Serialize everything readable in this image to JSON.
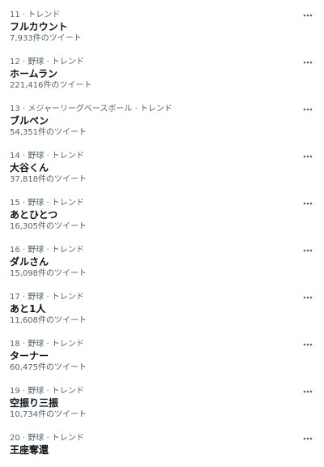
{
  "trends": [
    {
      "meta": "11 · トレンド",
      "name": "フルカウント",
      "count": "7,933件のツイート"
    },
    {
      "meta": "12 · 野球 · トレンド",
      "name": "ホームラン",
      "count": "221,416件のツイート"
    },
    {
      "meta": "13 · メジャーリーグベースボール · トレンド",
      "name": "ブルペン",
      "count": "54,351件のツイート"
    },
    {
      "meta": "14 · 野球 · トレンド",
      "name": "大谷くん",
      "count": "37,818件のツイート"
    },
    {
      "meta": "15 · 野球 · トレンド",
      "name": "あとひとつ",
      "count": "16,305件のツイート"
    },
    {
      "meta": "16 · 野球 · トレンド",
      "name": "ダルさん",
      "count": "15,098件のツイート"
    },
    {
      "meta": "17 · 野球 · トレンド",
      "name": "あと1人",
      "count": "11,608件のツイート"
    },
    {
      "meta": "18 · 野球 · トレンド",
      "name": "ターナー",
      "count": "60,475件のツイート"
    },
    {
      "meta": "19 · 野球 · トレンド",
      "name": "空振り三振",
      "count": "10,734件のツイート"
    },
    {
      "meta": "20 · 野球 · トレンド",
      "name": "王座奪還",
      "count": ""
    }
  ],
  "icons": {
    "more": "more-horizontal-icon"
  },
  "colors": {
    "text_primary": "#0f1419",
    "text_secondary": "#536471",
    "divider": "#eff3f4"
  }
}
